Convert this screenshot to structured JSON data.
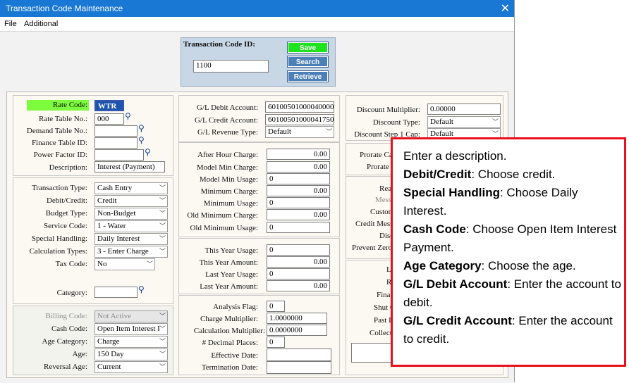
{
  "window": {
    "title": "Transaction Code Maintenance",
    "close": "✕"
  },
  "menu": [
    "File",
    "Additional"
  ],
  "header": {
    "id_label": "Transaction Code ID:",
    "id_value": "1100",
    "buttons": {
      "save": "Save",
      "search": "Search",
      "retrieve": "Retrieve"
    }
  },
  "left": {
    "rate_code": {
      "label": "Rate Code:",
      "value": "WTR"
    },
    "rate_table_no": {
      "label": "Rate Table No.:",
      "value": "000"
    },
    "demand_table_no": {
      "label": "Demand Table No.:",
      "value": ""
    },
    "finance_table_id": {
      "label": "Finance Table ID:",
      "value": ""
    },
    "power_factor_id": {
      "label": "Power Factor ID:",
      "value": ""
    },
    "description": {
      "label": "Description:",
      "value": "Interest (Payment)"
    },
    "transaction_type": {
      "label": "Transaction Type:",
      "value": "Cash Entry"
    },
    "debit_credit": {
      "label": "Debit/Credit:",
      "value": "Credit"
    },
    "budget_type": {
      "label": "Budget Type:",
      "value": "Non-Budget"
    },
    "service_code": {
      "label": "Service Code:",
      "value": "1 - Water"
    },
    "special_handling": {
      "label": "Special Handling:",
      "value": "Daily Interest"
    },
    "calculation_types": {
      "label": "Calculation Types:",
      "value": "3 - Enter Charge"
    },
    "tax_code": {
      "label": "Tax Code:",
      "value": "No"
    },
    "category": {
      "label": "Category:",
      "value": ""
    },
    "billing_code": {
      "label": "Billing Code:",
      "value": "Not Active"
    },
    "cash_code": {
      "label": "Cash Code:",
      "value": "Open Item Interest P"
    },
    "age_category": {
      "label": "Age Category:",
      "value": "Charge"
    },
    "age": {
      "label": "Age:",
      "value": "150 Day"
    },
    "reversal_age": {
      "label": "Reversal Age:",
      "value": "Current"
    }
  },
  "middle": {
    "gl_debit": {
      "label": "G/L Debit Account:",
      "value": "601005010000400000"
    },
    "gl_credit": {
      "label": "G/L Credit Account:",
      "value": "601005010000417500"
    },
    "gl_revenue_type": {
      "label": "G/L Revenue Type:",
      "value": "Default"
    },
    "after_hour_charge": {
      "label": "After Hour Charge:",
      "value": "0.00"
    },
    "model_min_charge": {
      "label": "Model Min Charge:",
      "value": "0.00"
    },
    "model_min_usage": {
      "label": "Model Min Usage:",
      "value": "0"
    },
    "minimum_charge": {
      "label": "Minimum Charge:",
      "value": "0.00"
    },
    "minimum_usage": {
      "label": "Minimum Usage:",
      "value": "0"
    },
    "old_minimum_charge": {
      "label": "Old Minimum Charge:",
      "value": "0.00"
    },
    "old_minimum_usage": {
      "label": "Old Minimum Usage:",
      "value": "0"
    },
    "this_year_usage": {
      "label": "This Year Usage:",
      "value": "0"
    },
    "this_year_amount": {
      "label": "This Year Amount:",
      "value": "0.00"
    },
    "last_year_usage": {
      "label": "Last Year Usage:",
      "value": "0"
    },
    "last_year_amount": {
      "label": "Last Year Amount:",
      "value": "0.00"
    },
    "analysis_flag": {
      "label": "Analysis Flag:",
      "value": "0"
    },
    "charge_multiplier": {
      "label": "Charge Multiplier:",
      "value": "1.0000000"
    },
    "calculation_multiplier": {
      "label": "Calculation Multiplier:",
      "value": "0.0000000"
    },
    "decimal_places": {
      "label": "# Decimal Places:",
      "value": "0"
    },
    "effective_date": {
      "label": "Effective Date:",
      "value": ""
    },
    "termination_date": {
      "label": "Termination Date:",
      "value": ""
    }
  },
  "right": {
    "discount_multiplier": {
      "label": "Discount Multiplier:",
      "value": "0.00000"
    },
    "discount_type": {
      "label": "Discount Type:",
      "value": "Default"
    },
    "discount_step1_cap": {
      "label": "Discount Step 1 Cap:",
      "value": "Default"
    },
    "partial_labels": [
      "Prorate Ca",
      "Prorate C",
      "Rea",
      "Mess",
      "Custon",
      "Credit Mess",
      "Disc",
      "Prevent Zero",
      "L",
      "R",
      "Finar",
      "Shut O",
      "Past D",
      "Collect"
    ]
  },
  "callout": {
    "lines": [
      {
        "bold": "",
        "text": "Enter a description."
      },
      {
        "bold": "Debit/Credit",
        "text": ":  Choose credit."
      },
      {
        "bold": "Special Handling",
        "text": ":  Choose Daily Interest."
      },
      {
        "bold": "Cash Code",
        "text": ":  Choose Open Item Interest Payment."
      },
      {
        "bold": "Age Category",
        "text": ":  Choose the age."
      },
      {
        "bold": "G/L Debit Account",
        "text": ":  Enter the account to debit."
      },
      {
        "bold": "G/L Credit Account",
        "text": ":  Enter the account to credit."
      }
    ]
  },
  "colors": {
    "titlebar": "#1978d4",
    "rate_code_highlight": "#7cfc3c",
    "save_button": "#1ee41e",
    "button_blue": "#4b7fb8",
    "callout_border": "#e8101a"
  }
}
